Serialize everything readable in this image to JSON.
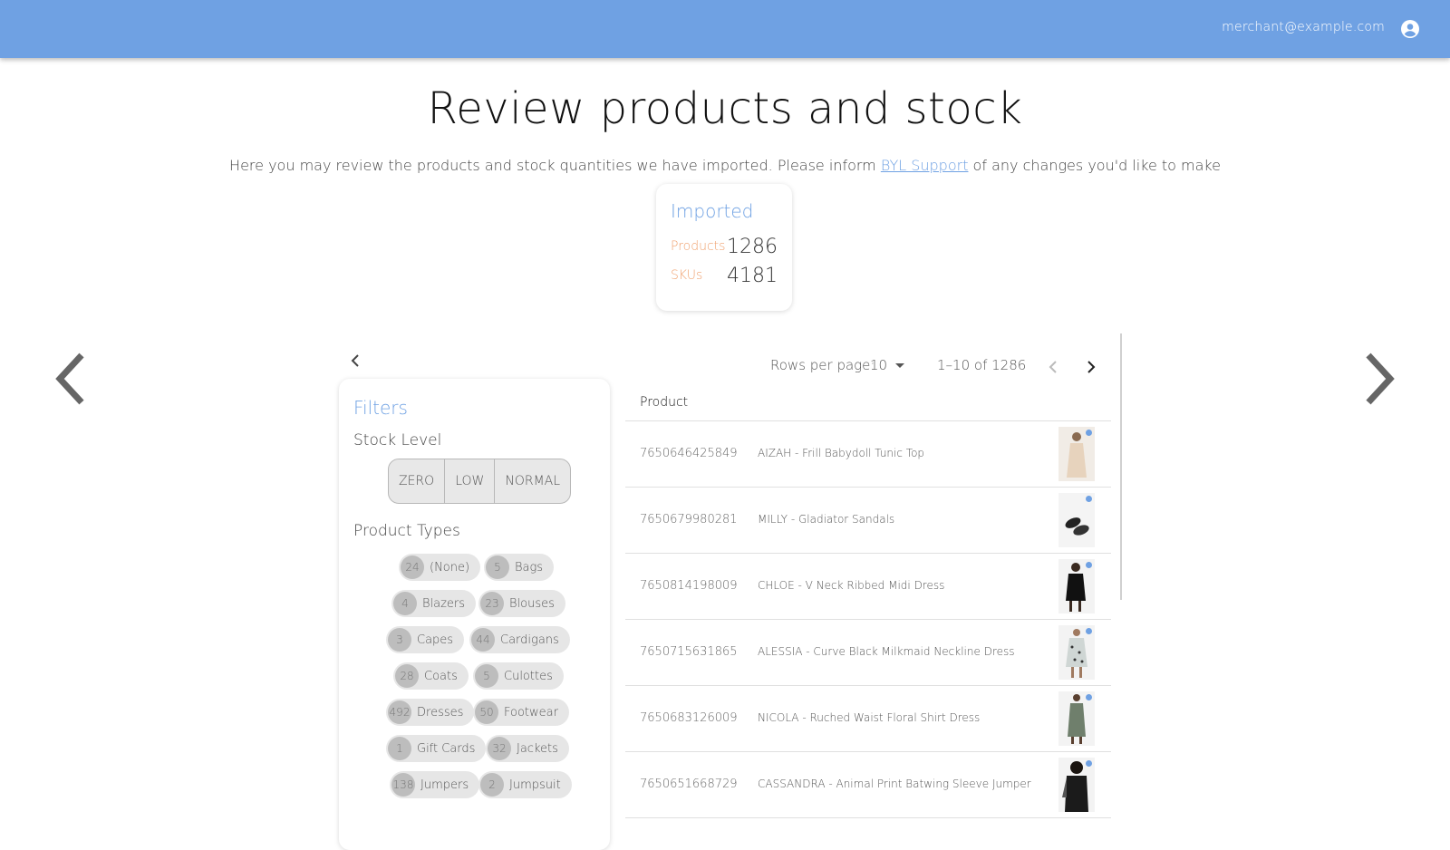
{
  "header": {
    "user_email": "merchant@example.com",
    "accent": "#6fa1e3"
  },
  "page": {
    "title": "Review products and stock",
    "subtitle_prefix": "Here you may review the products and stock quantities we have imported. Please inform ",
    "subtitle_link": "BYL Support",
    "subtitle_suffix": " of any changes you'd like to make"
  },
  "imported": {
    "title": "Imported",
    "products_label": "Products",
    "products_value": "1286",
    "skus_label": "SKUs",
    "skus_value": "4181"
  },
  "filters": {
    "title": "Filters",
    "stock_level_label": "Stock Level",
    "stock_levels": [
      "ZERO",
      "LOW",
      "NORMAL"
    ],
    "product_types_label": "Product Types",
    "product_types": [
      {
        "count": "24",
        "name": "(None)"
      },
      {
        "count": "5",
        "name": "Bags"
      },
      {
        "count": "4",
        "name": "Blazers"
      },
      {
        "count": "23",
        "name": "Blouses"
      },
      {
        "count": "3",
        "name": "Capes"
      },
      {
        "count": "44",
        "name": "Cardigans"
      },
      {
        "count": "28",
        "name": "Coats"
      },
      {
        "count": "5",
        "name": "Culottes"
      },
      {
        "count": "492",
        "name": "Dresses"
      },
      {
        "count": "50",
        "name": "Footwear"
      },
      {
        "count": "1",
        "name": "Gift Cards"
      },
      {
        "count": "32",
        "name": "Jackets"
      },
      {
        "count": "138",
        "name": "Jumpers"
      },
      {
        "count": "2",
        "name": "Jumpsuit"
      }
    ]
  },
  "pagination": {
    "rows_label": "Rows per page:",
    "rows_value": "10",
    "range": "1–10 of 1286"
  },
  "table": {
    "column_header": "Product",
    "rows": [
      {
        "sku": "7650646425849",
        "name": "AIZAH - Frill Babydoll Tunic Top"
      },
      {
        "sku": "7650679980281",
        "name": "MILLY - Gladiator Sandals"
      },
      {
        "sku": "7650814198009",
        "name": "CHLOE - V Neck Ribbed Midi Dress"
      },
      {
        "sku": "7650715631865",
        "name": "ALESSIA - Curve Black Milkmaid Neckline Dress"
      },
      {
        "sku": "7650683126009",
        "name": "NICOLA - Ruched Waist Floral Shirt Dress"
      },
      {
        "sku": "7650651668729",
        "name": "CASSANDRA - Animal Print Batwing Sleeve Jumper"
      }
    ]
  }
}
